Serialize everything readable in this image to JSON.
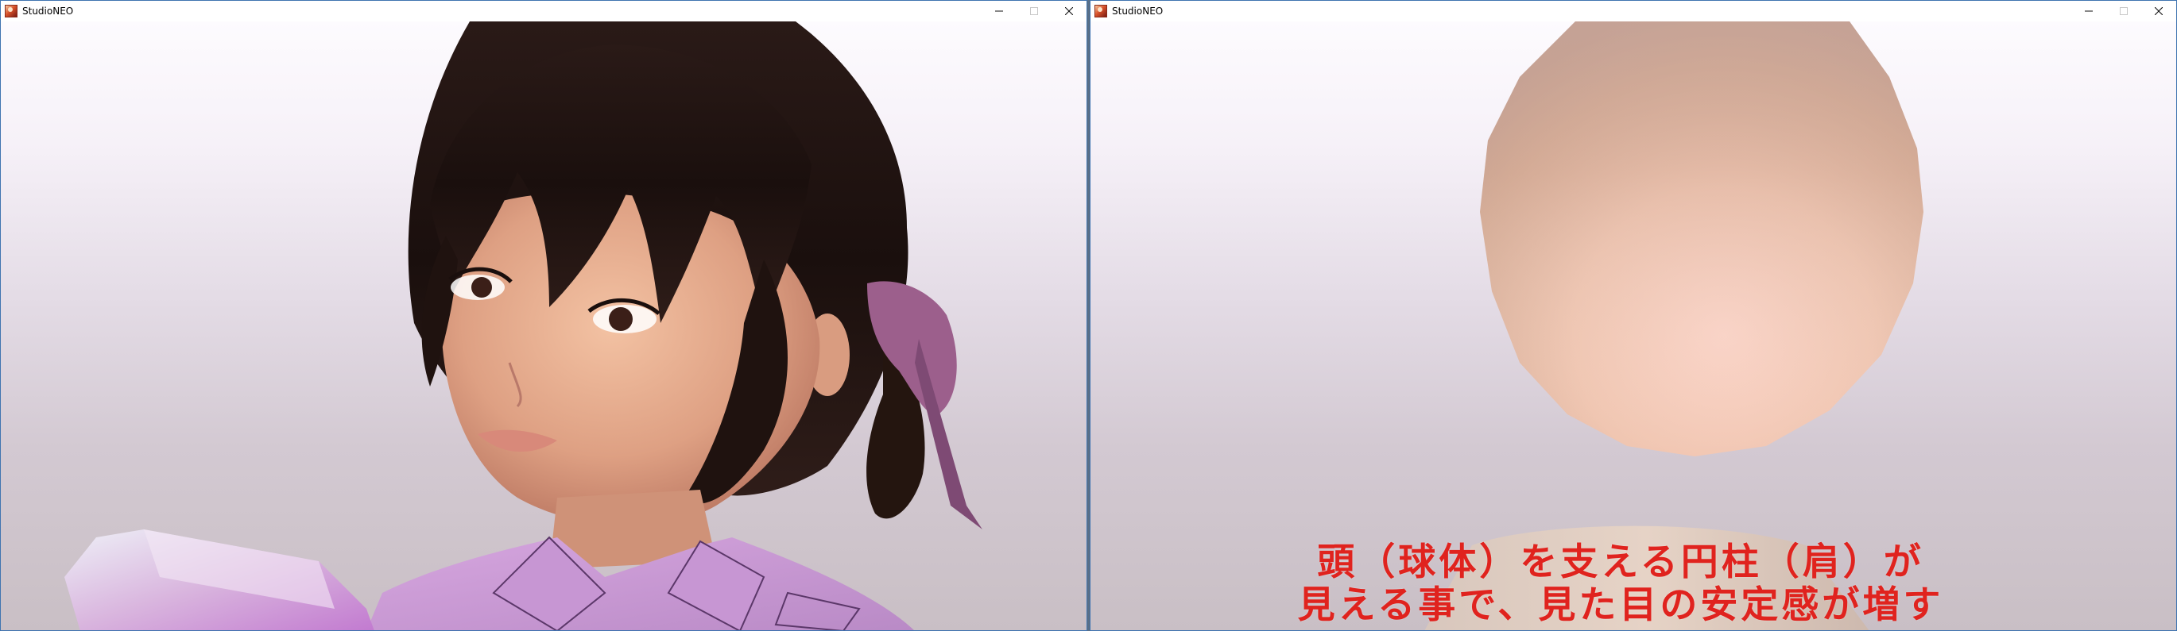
{
  "windows": [
    {
      "title": "StudioNEO",
      "scene": "character-head-closeup"
    },
    {
      "title": "StudioNEO",
      "scene": "sphere-on-cylinder",
      "caption": {
        "line1": "頭（球体）を支える円柱（肩）が",
        "line2": "見える事で、見た目の安定感が増す",
        "color": "#e0231e"
      }
    }
  ],
  "controls": {
    "minimize": "─",
    "maximize": "□",
    "close": "✕"
  },
  "icons": {
    "app": "studioneo-app-icon",
    "minimize": "minimize-icon",
    "maximize": "maximize-icon",
    "close": "close-icon"
  }
}
